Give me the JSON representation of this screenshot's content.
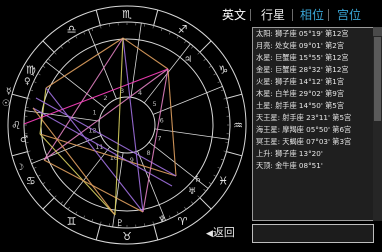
{
  "tabs": [
    {
      "label": "英文",
      "state": "active"
    },
    {
      "label": "行星",
      "state": "normal"
    },
    {
      "label": "相位",
      "state": "muted"
    },
    {
      "label": "宫位",
      "state": "muted"
    }
  ],
  "planets": [
    {
      "label": "太阳: 狮子座 05°19'  第12宫"
    },
    {
      "label": "月亮: 处女座 09°01'  第2宫"
    },
    {
      "label": "水星: 巨蟹座 15°55'  第12宫"
    },
    {
      "label": "金星: 巨蟹座 28°32'  第12宫"
    },
    {
      "label": "火星: 狮子座 14°12'  第1宫"
    },
    {
      "label": "木星: 白羊座 29°02'  第9宫"
    },
    {
      "label": "土星: 射手座 14°50'  第5宫"
    },
    {
      "label": "天王星: 射手座 23°11'  第5宫"
    },
    {
      "label": "海王星: 摩羯座 05°50'  第6宫"
    },
    {
      "label": "冥王星: 天蝎座 07°03'  第3宫"
    },
    {
      "label": "上升: 狮子座 13°20'"
    },
    {
      "label": "天顶: 金牛座 08°51'"
    }
  ],
  "back_label": "返回",
  "colors": {
    "background": "#000000",
    "wheel_line": "#d9d9d9",
    "aspect_orange": "#e0a060",
    "aspect_violet": "#a070e0",
    "aspect_pink": "#e080c0",
    "aspect_yellow": "#d8d060",
    "aspect_magenta": "#ff40c0"
  },
  "sign_icons": [
    "leo-icon",
    "cancer-icon",
    "gemini-icon",
    "taurus-icon",
    "aries-icon",
    "pisces-icon",
    "aquarius-icon",
    "capricorn-icon",
    "sagittarius-icon",
    "scorpio-icon",
    "libra-icon",
    "virgo-icon"
  ],
  "house_numbers": [
    "1",
    "2",
    "3",
    "4",
    "5",
    "6",
    "7",
    "8",
    "9",
    "10",
    "11",
    "12"
  ]
}
